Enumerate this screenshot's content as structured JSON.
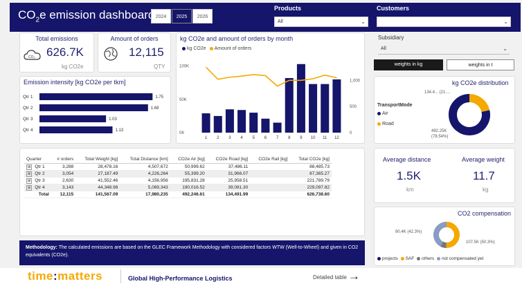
{
  "header": {
    "title_main": "CO",
    "title_sub": "2",
    "title_rest": "e emission dashboard",
    "years": [
      "2024",
      "2025",
      "2026"
    ],
    "active_year": "2025",
    "products_label": "Products",
    "products_value": "All",
    "customers_label": "Customers",
    "customers_value": ""
  },
  "total_emissions": {
    "title": "Total emissions",
    "value": "626.7K",
    "unit": "kg CO2e",
    "icon": "co2-cloud-icon"
  },
  "orders": {
    "title": "Amount of orders",
    "value": "12,115",
    "unit": "QTY",
    "icon": "globe-icon"
  },
  "subsidiary": {
    "label": "Subsidiary",
    "value": "All"
  },
  "weight_toggle": {
    "kg": "weights in kg",
    "t": "weights in t"
  },
  "intensity": {
    "title": "Emission intensity [kg CO2e per tkm]",
    "chart_data": {
      "type": "bar",
      "categories": [
        "Qtr 1",
        "Qtr 2",
        "Qtr 3",
        "Qtr 4"
      ],
      "values": [
        1.75,
        1.68,
        1.03,
        1.13
      ],
      "labels": [
        "1.75",
        "1.68",
        "1.03",
        "1.13"
      ]
    }
  },
  "monthly": {
    "title": "kg CO2e and amount of orders by month",
    "legend": [
      "kg CO2e",
      "Amount of orders"
    ],
    "left_ticks": [
      "100K",
      "50K",
      "0K"
    ],
    "right_ticks": [
      "1,000",
      "500",
      "0"
    ],
    "chart_data": {
      "type": "bar",
      "categories": [
        "1",
        "2",
        "3",
        "4",
        "5",
        "6",
        "7",
        "8",
        "9",
        "10",
        "11",
        "12"
      ],
      "series": [
        {
          "name": "kg CO2e",
          "values": [
            29000,
            25000,
            35000,
            34000,
            30000,
            21000,
            15000,
            82000,
            103000,
            73000,
            73000,
            80000
          ]
        },
        {
          "name": "Amount of orders",
          "values": [
            1250,
            1020,
            1060,
            1080,
            1110,
            1090,
            890,
            1000,
            1000,
            1030,
            1100,
            1050
          ]
        }
      ],
      "ylim": [
        0,
        110000
      ],
      "y2lim": [
        0,
        1400
      ]
    }
  },
  "distribution": {
    "title": "kg CO2e distribution",
    "legend_title": "TransportMode",
    "legend": [
      "Air",
      "Road"
    ],
    "label_top": "134.4... (21....",
    "label_bottom_1": "492.25K",
    "label_bottom_2": "(78.54%)",
    "chart_data": {
      "type": "pie",
      "categories": [
        "Air",
        "Road"
      ],
      "values": [
        78.54,
        21.46
      ]
    }
  },
  "table": {
    "headers": [
      "Quarter",
      "# orders",
      "Total Weight [kg]",
      "Total Distance [km]",
      "CO2e Air [kg]",
      "CO2e Road [kg]",
      "CO2e Rail [kg]",
      "Total CO2e [kg]"
    ],
    "rows": [
      [
        "Qtr 1",
        "3,288",
        "28,478.16",
        "4,507,672",
        "50,999.62",
        "37,486.11",
        "",
        "88,485.73"
      ],
      [
        "Qtr 2",
        "3,054",
        "27,187.49",
        "4,226,264",
        "55,399.20",
        "31,966.07",
        "",
        "87,365.27"
      ],
      [
        "Qtr 3",
        "2,630",
        "41,552.46",
        "4,156,956",
        "195,831.28",
        "25,958.51",
        "",
        "221,789.79"
      ],
      [
        "Qtr 4",
        "3,143",
        "44,348.98",
        "5,089,343",
        "190,016.52",
        "39,081.30",
        "",
        "229,097.82"
      ]
    ],
    "total": [
      "Total",
      "12,115",
      "141,567.09",
      "17,980,235",
      "492,246.61",
      "134,491.99",
      "",
      "626,738.60"
    ]
  },
  "avg_distance": {
    "title": "Average distance",
    "value": "1.5K",
    "unit": "km"
  },
  "avg_weight": {
    "title": "Average weight",
    "value": "11.7",
    "unit": "kg"
  },
  "compensation": {
    "title": "CO2 compensation",
    "label_left": "90.4K (42.3%)",
    "label_right": "107.5K (50.3%)",
    "legend": [
      "projects",
      "SAF",
      "others",
      "not compensated yet"
    ],
    "chart_data": {
      "type": "pie",
      "categories": [
        "projects",
        "SAF",
        "others",
        "not compensated yet"
      ],
      "values": [
        42.3,
        50.3,
        7.4,
        0
      ]
    }
  },
  "methodology": {
    "label": "Methodology:",
    "text": " The calculated emissions are based on the GLEC Framework Methodology with considered factors WTW (Well-to-Wheel) and given in CO2 equivalents (CO2e)."
  },
  "footer": {
    "logo_left": "time",
    "logo_colon": ":",
    "logo_right": "matters",
    "tagline": "Global High-Performance Logistics",
    "detail_link": "Detailed table",
    "arrow": "→"
  },
  "colors": {
    "navy": "#15156b",
    "orange": "#f5a800",
    "blue_gray": "#8a9bc4"
  }
}
